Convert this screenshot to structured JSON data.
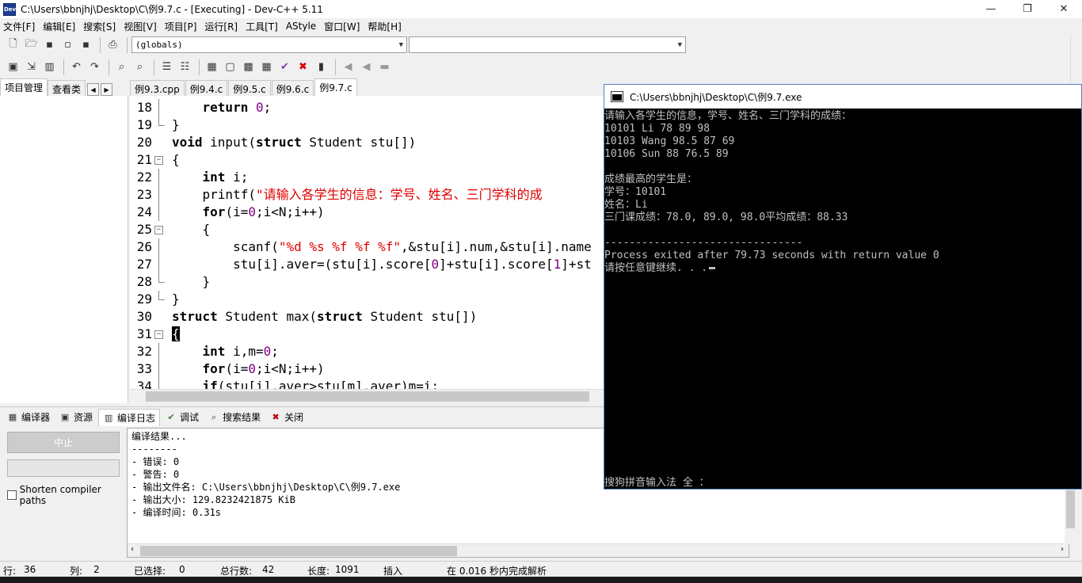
{
  "window": {
    "title": "C:\\Users\\bbnjhj\\Desktop\\C\\例9.7.c - [Executing] - Dev-C++ 5.11",
    "minimize": "—",
    "maximize": "❐",
    "close": "✕"
  },
  "menu": [
    "文件[F]",
    "编辑[E]",
    "搜索[S]",
    "视图[V]",
    "项目[P]",
    "运行[R]",
    "工具[T]",
    "AStyle",
    "窗口[W]",
    "帮助[H]"
  ],
  "toolbar": {
    "scope_combo": "(globals)",
    "symbol_combo": ""
  },
  "left_panel": {
    "tabs": [
      "项目管理",
      "查看类"
    ]
  },
  "file_tabs": [
    "例9.3.cpp",
    "例9.4.c",
    "例9.5.c",
    "例9.6.c",
    "例9.7.c"
  ],
  "editor": {
    "lines": [
      {
        "n": "18",
        "code": "    return 0;"
      },
      {
        "n": "19",
        "code": "}"
      },
      {
        "n": "20",
        "code": "void input(struct Student stu[])"
      },
      {
        "n": "21",
        "code": "{"
      },
      {
        "n": "22",
        "code": "    int i;"
      },
      {
        "n": "23",
        "code": "    printf(\"请输入各学生的信息：学号、姓名、三门学科的成"
      },
      {
        "n": "24",
        "code": "    for(i=0;i<N;i++)"
      },
      {
        "n": "25",
        "code": "    {"
      },
      {
        "n": "26",
        "code": "        scanf(\"%d %s %f %f %f\",&stu[i].num,&stu[i].name"
      },
      {
        "n": "27",
        "code": "        stu[i].aver=(stu[i].score[0]+stu[i].score[1]+st"
      },
      {
        "n": "28",
        "code": "    }"
      },
      {
        "n": "29",
        "code": "}"
      },
      {
        "n": "30",
        "code": "struct Student max(struct Student stu[])"
      },
      {
        "n": "31",
        "code": "{"
      },
      {
        "n": "32",
        "code": "    int i,m=0;"
      },
      {
        "n": "33",
        "code": "    for(i=0;i<N;i++)"
      },
      {
        "n": "34",
        "code": "    if(stu[i].aver>stu[m].aver)m=i;"
      }
    ]
  },
  "bottom_tabs": [
    {
      "label": "编译器",
      "icon": "grid-icon"
    },
    {
      "label": "资源",
      "icon": "resources-icon"
    },
    {
      "label": "编译日志",
      "icon": "chart-icon"
    },
    {
      "label": "调试",
      "icon": "check-icon"
    },
    {
      "label": "搜索结果",
      "icon": "search-icon"
    },
    {
      "label": "关闭",
      "icon": "close-icon"
    }
  ],
  "compile_panel": {
    "stop_label": "中止",
    "shorten_label": "Shorten compiler paths"
  },
  "compile_log": [
    "编译结果...",
    "--------",
    "- 错误: 0",
    "- 警告: 0",
    "- 输出文件名: C:\\Users\\bbnjhj\\Desktop\\C\\例9.7.exe",
    "- 输出大小: 129.8232421875 KiB",
    "- 编译时间: 0.31s"
  ],
  "status": {
    "row_label": "行:",
    "row": "36",
    "col_label": "列:",
    "col": "2",
    "sel_label": "已选择:",
    "sel": "0",
    "total_label": "总行数:",
    "total": "42",
    "len_label": "长度:",
    "len": "1091",
    "mode": "插入",
    "parse": "在 0.016 秒内完成解析"
  },
  "console": {
    "title": "C:\\Users\\bbnjhj\\Desktop\\C\\例9.7.exe",
    "lines": [
      "请输入各学生的信息，学号、姓名、三门学科的成绩：",
      "10101 Li 78 89 98",
      "10103 Wang 98.5 87 69",
      "10106 Sun 88 76.5 89",
      "",
      "成绩最高的学生是：",
      "学号：10101",
      "姓名：Li",
      "三门课成绩：78.0, 89.0, 98.0平均成绩：88.33",
      "",
      "--------------------------------",
      "Process exited after 79.73 seconds with return value 0",
      "请按任意键继续. . ."
    ],
    "ime": "搜狗拼音输入法 全 ："
  },
  "colors": {
    "keyword": "#000000",
    "string": "#e00000",
    "number": "#800080",
    "console_bg": "#000000",
    "console_fg": "#c0c0c0"
  }
}
